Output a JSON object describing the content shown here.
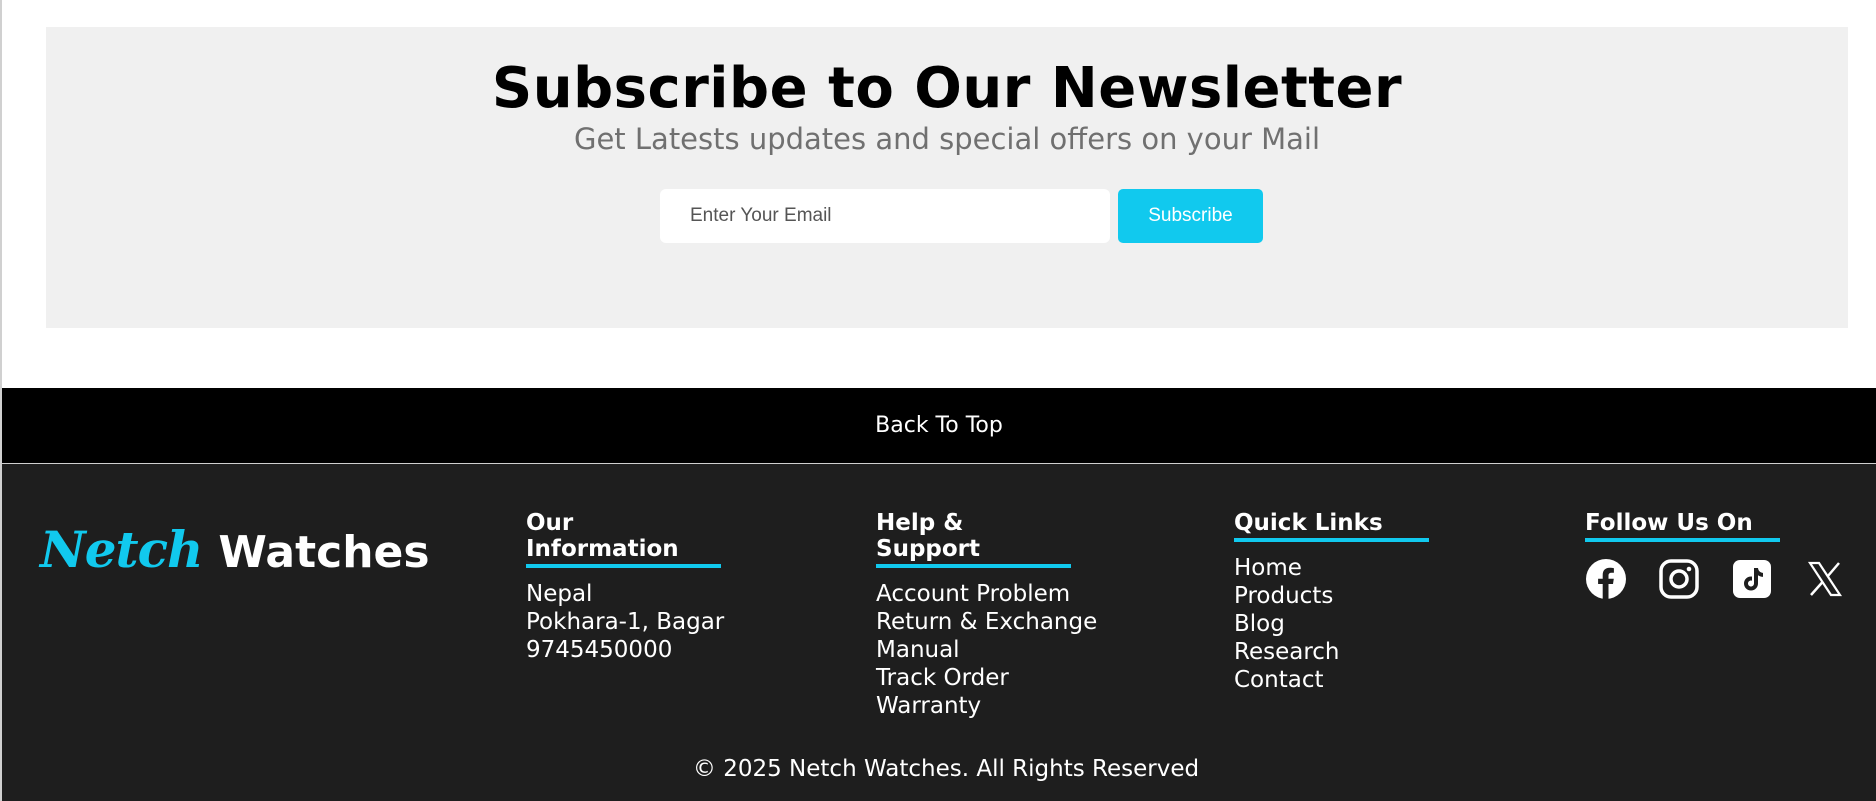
{
  "newsletter": {
    "title": "Subscribe to Our Newsletter",
    "subtitle": "Get Latests updates and special offers on your Mail",
    "email_placeholder": "Enter Your Email",
    "email_value": "",
    "subscribe_label": "Subscribe"
  },
  "back_to_top": "Back To Top",
  "footer": {
    "logo_script": "Netch",
    "logo_word": "Watches",
    "info": {
      "title": "Our Information",
      "items": [
        "Nepal",
        "Pokhara-1, Bagar",
        "9745450000"
      ]
    },
    "help": {
      "title": "Help & Support",
      "items": [
        "Account Problem",
        "Return & Exchange",
        "Manual",
        "Track Order",
        "Warranty"
      ]
    },
    "quick": {
      "title": "Quick Links",
      "items": [
        "Home",
        "Products",
        "Blog",
        "Research",
        "Contact"
      ]
    },
    "follow": {
      "title": "Follow Us On",
      "icons": [
        "facebook-icon",
        "instagram-icon",
        "tiktok-icon",
        "x-icon"
      ]
    },
    "copyright": "© 2025 Netch Watches. All Rights Reserved"
  },
  "colors": {
    "accent": "#11c9ee",
    "footer_bg": "#1e1e1e",
    "back_to_top_bg": "#000000",
    "newsletter_bg": "#f0f0f0"
  }
}
